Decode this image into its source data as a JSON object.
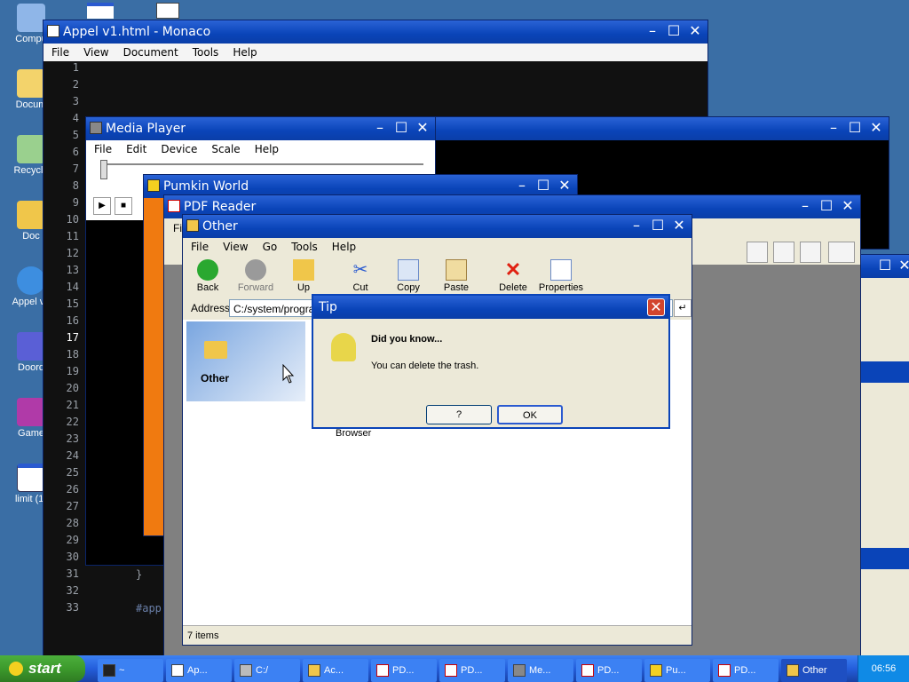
{
  "desktop": {
    "icons": [
      {
        "label": "Compu",
        "glyph": "computer-icon"
      },
      {
        "label": "Docum",
        "glyph": "documents-icon"
      },
      {
        "label": "Recycle",
        "glyph": "recycle-icon"
      },
      {
        "label": "Doc",
        "glyph": "folder-icon"
      },
      {
        "label": "Appel v1",
        "glyph": "browser-icon"
      },
      {
        "label": "Doord",
        "glyph": "game-icon"
      },
      {
        "label": "Game",
        "glyph": "games-icon"
      },
      {
        "label": "limit (1)",
        "glyph": "document-icon"
      }
    ]
  },
  "monaco": {
    "title": "Appel v1.html - Monaco",
    "menu": [
      "File",
      "View",
      "Document",
      "Tools",
      "Help"
    ],
    "line_numbers": [
      "1",
      "2",
      "3",
      "4",
      "5",
      "6",
      "7",
      "8",
      "9",
      "10",
      "11",
      "12",
      "13",
      "14",
      "15",
      "16",
      "17",
      "18",
      "19",
      "20",
      "21",
      "22",
      "23",
      "24",
      "25",
      "26",
      "27",
      "28",
      "29",
      "30",
      "31",
      "32",
      "33"
    ],
    "code_line_31": "}",
    "code_line_33": "#app"
  },
  "media_player": {
    "title": "Media Player",
    "menu": [
      "File",
      "Edit",
      "Device",
      "Scale",
      "Help"
    ]
  },
  "pumkin": {
    "title": "Pumkin World"
  },
  "pdf": {
    "title": "PDF Reader",
    "menu_first": "Fi"
  },
  "other": {
    "title": "Other",
    "menu": [
      "File",
      "View",
      "Go",
      "Tools",
      "Help"
    ],
    "toolbar": {
      "back": "Back",
      "forward": "Forward",
      "up": "Up",
      "cut": "Cut",
      "copy": "Copy",
      "paste": "Paste",
      "delete": "Delete",
      "properties": "Properties"
    },
    "address_label": "Address",
    "address_value": "C:/system/program",
    "side_label": "Other",
    "browser_label": "Browser",
    "status": "7 items"
  },
  "tip": {
    "title": "Tip",
    "heading": "Did you know...",
    "message": "You can delete the trash.",
    "help_button": "?",
    "ok_button": "OK"
  },
  "taskbar": {
    "start": "start",
    "clock": "06:56",
    "items": [
      {
        "label": "~"
      },
      {
        "label": "Ap..."
      },
      {
        "label": "C:/"
      },
      {
        "label": "Ac..."
      },
      {
        "label": "PD..."
      },
      {
        "label": "PD..."
      },
      {
        "label": "Me..."
      },
      {
        "label": "PD..."
      },
      {
        "label": "Pu..."
      },
      {
        "label": "PD..."
      },
      {
        "label": "Other"
      }
    ]
  }
}
